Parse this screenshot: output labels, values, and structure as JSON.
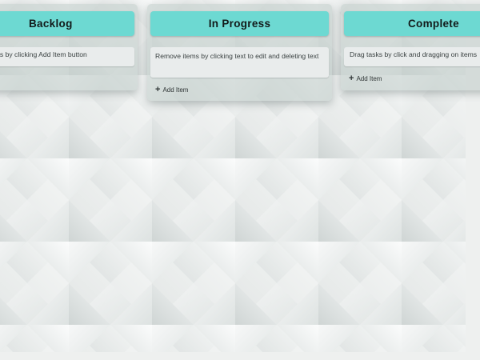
{
  "columns": {
    "backlog": {
      "title": "Backlog",
      "item": "Add items by clicking Add Item button"
    },
    "in_progress": {
      "title": "In Progress",
      "item": "Remove items by clicking text to edit and deleting text",
      "add_label": "Add Item"
    },
    "complete": {
      "title": "Complete",
      "item": "Drag tasks by click and dragging on items",
      "add_label": "Add Item"
    }
  },
  "icons": {
    "add": "plus-icon"
  },
  "colors": {
    "header": "#6dd9d2",
    "background": "#eef0ef"
  }
}
